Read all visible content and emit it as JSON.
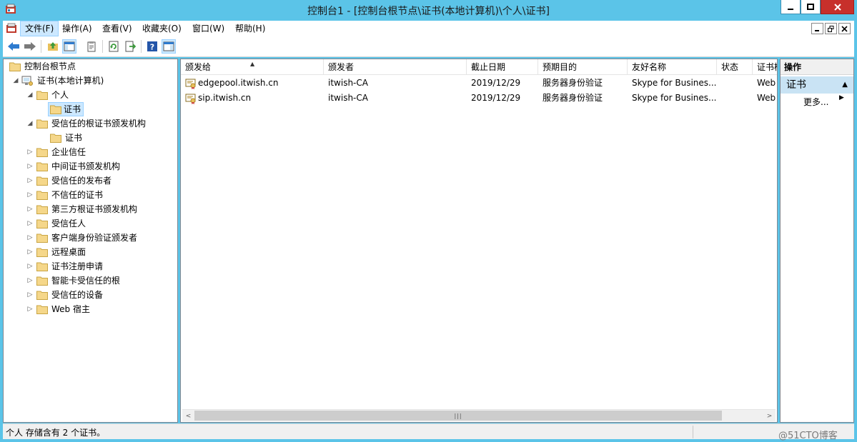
{
  "window": {
    "title": "控制台1 - [控制台根节点\\证书(本地计算机)\\个人\\证书]"
  },
  "menu": {
    "items": [
      {
        "label": "文件(F)",
        "active": true
      },
      {
        "label": "操作(A)"
      },
      {
        "label": "查看(V)"
      },
      {
        "label": "收藏夹(O)"
      },
      {
        "label": "窗口(W)"
      },
      {
        "label": "帮助(H)"
      }
    ]
  },
  "toolbar": {
    "buttons": [
      "back-icon",
      "forward-icon",
      "up-folder-icon",
      "show-hide-tree-icon",
      "properties-icon",
      "refresh-icon",
      "export-list-icon",
      "help-icon",
      "show-hide-action-pane-icon"
    ]
  },
  "tree": {
    "root": "控制台根节点",
    "store": "证书(本地计算机)",
    "personal": "个人",
    "personal_certs": "证书",
    "trusted_root": "受信任的根证书颁发机构",
    "trusted_root_certs": "证书",
    "children": [
      "企业信任",
      "中间证书颁发机构",
      "受信任的发布者",
      "不信任的证书",
      "第三方根证书颁发机构",
      "受信任人",
      "客户端身份验证颁发者",
      "远程桌面",
      "证书注册申请",
      "智能卡受信任的根",
      "受信任的设备",
      "Web 宿主"
    ]
  },
  "list": {
    "columns": [
      "颁发给",
      "颁发者",
      "截止日期",
      "预期目的",
      "友好名称",
      "状态",
      "证书模板"
    ],
    "rows": [
      {
        "issued_to": "edgepool.itwish.cn",
        "issued_by": "itwish-CA",
        "expiry": "2019/12/29",
        "purpose": "服务器身份验证",
        "friendly_name": "Skype for Busines...",
        "status": "",
        "template": "Web"
      },
      {
        "issued_to": "sip.itwish.cn",
        "issued_by": "itwish-CA",
        "expiry": "2019/12/29",
        "purpose": "服务器身份验证",
        "friendly_name": "Skype for Busines...",
        "status": "",
        "template": "Web"
      }
    ]
  },
  "actions": {
    "title": "操作",
    "section": "证书",
    "more": "更多..."
  },
  "status": {
    "text": "个人 存储含有 2 个证书。"
  },
  "watermark": "@51CTO博客",
  "colors": {
    "titlebar": "#5bc4e8",
    "selection": "#cce8ff",
    "action_section": "#c9e3f4",
    "close_button": "#c7302b"
  }
}
